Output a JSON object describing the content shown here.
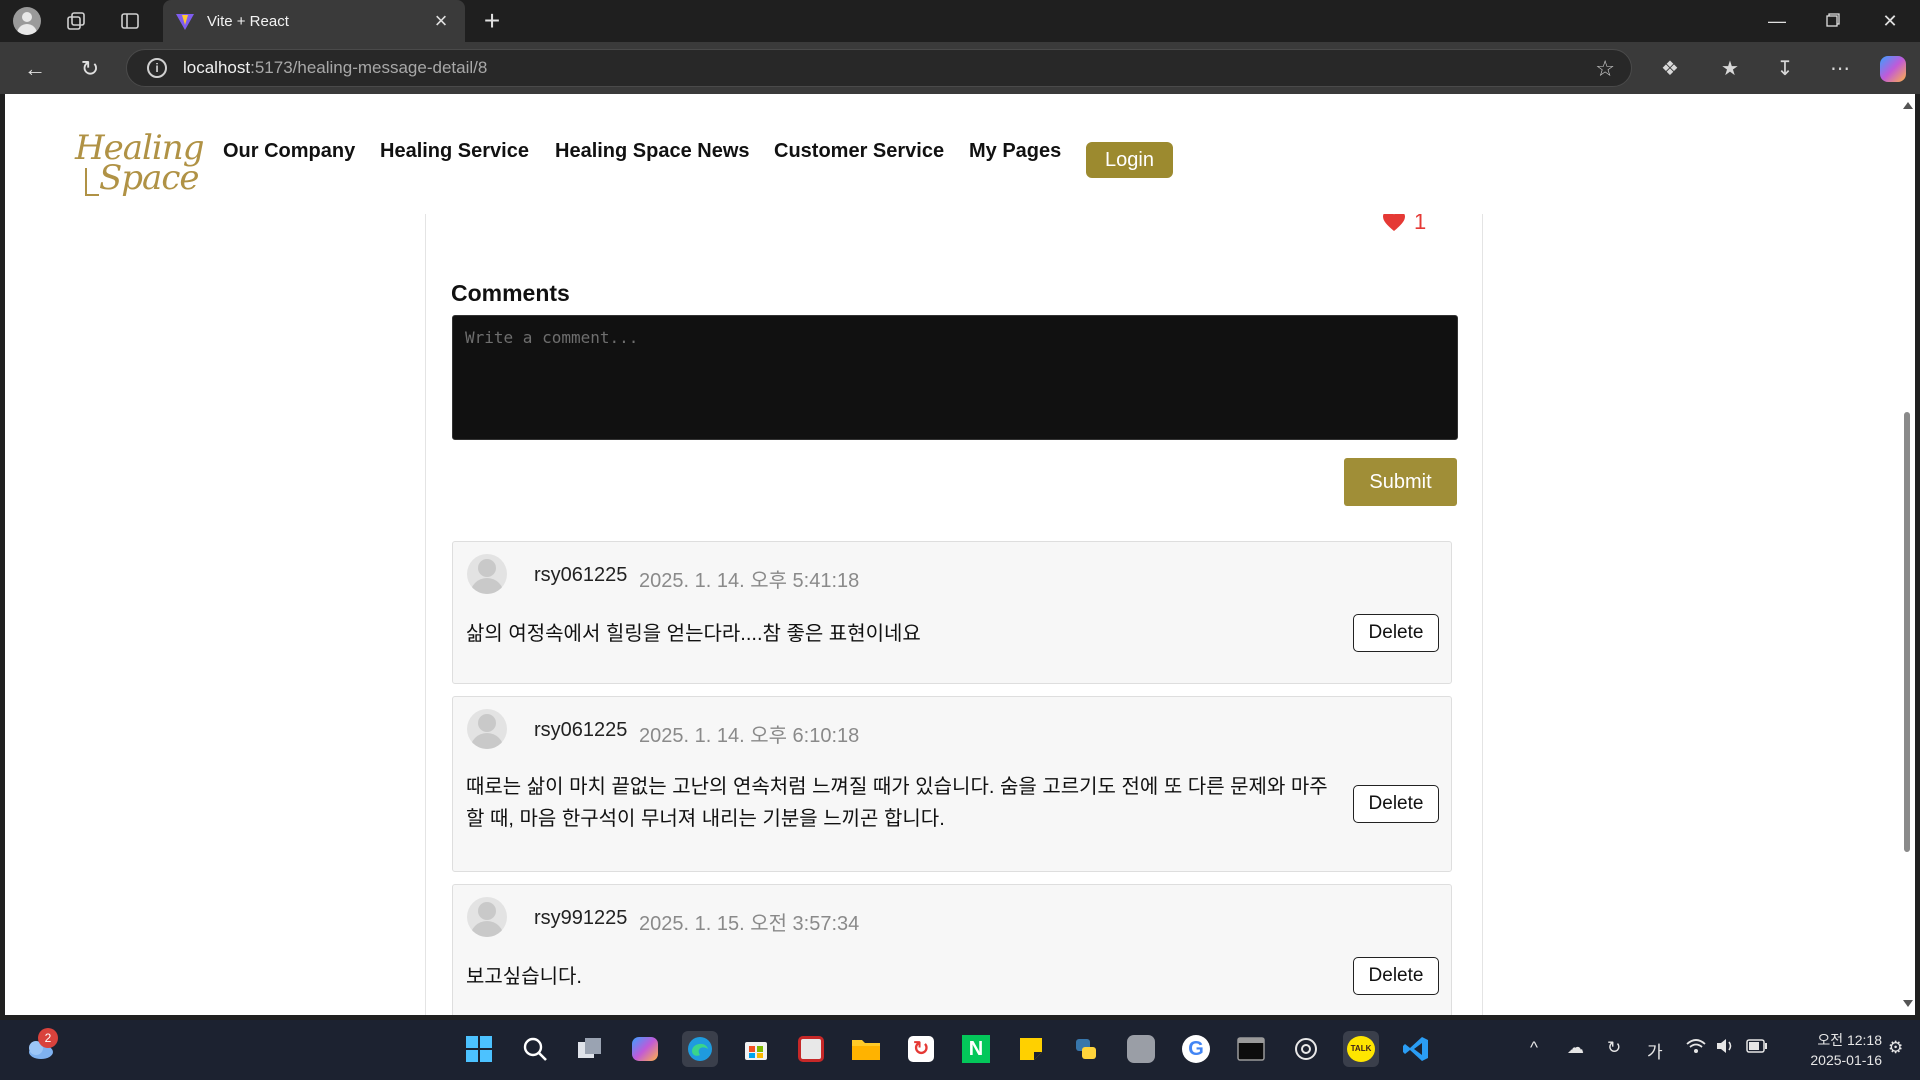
{
  "browser": {
    "tab_title": "Vite + React",
    "url_host": "localhost",
    "url_rest": ":5173/healing-message-detail/8",
    "new_tab_symbol": "+",
    "close_symbol": "×"
  },
  "site": {
    "logo_line1": "Healing",
    "logo_line2": "Space",
    "nav": [
      "Our Company",
      "Healing Service",
      "Healing Space News",
      "Customer Service",
      "My Pages"
    ],
    "login_label": "Login",
    "brand_color": "#9c8a2f"
  },
  "post": {
    "like_count": "1"
  },
  "comments_section": {
    "title": "Comments",
    "placeholder": "Write a comment...",
    "submit_label": "Submit",
    "delete_label": "Delete",
    "items": [
      {
        "user": "rsy061225",
        "date": "2025. 1. 14. 오후 5:41:18",
        "text": "삶의 여정속에서 힐링을 얻는다라....참 좋은 표현이네요"
      },
      {
        "user": "rsy061225",
        "date": "2025. 1. 14. 오후 6:10:18",
        "text": "때로는 삶이 마치 끝없는 고난의 연속처럼 느껴질 때가 있습니다. 숨을 고르기도 전에 또 다른 문제와 마주할 때, 마음 한구석이 무너져 내리는 기분을 느끼곤 합니다."
      },
      {
        "user": "rsy991225",
        "date": "2025. 1. 15. 오전 3:57:34",
        "text": "보고싶습니다."
      }
    ]
  },
  "taskbar": {
    "weather_badge": "2",
    "ime_label": "가",
    "clock_time": "오전 12:18",
    "clock_date": "2025-01-16"
  }
}
